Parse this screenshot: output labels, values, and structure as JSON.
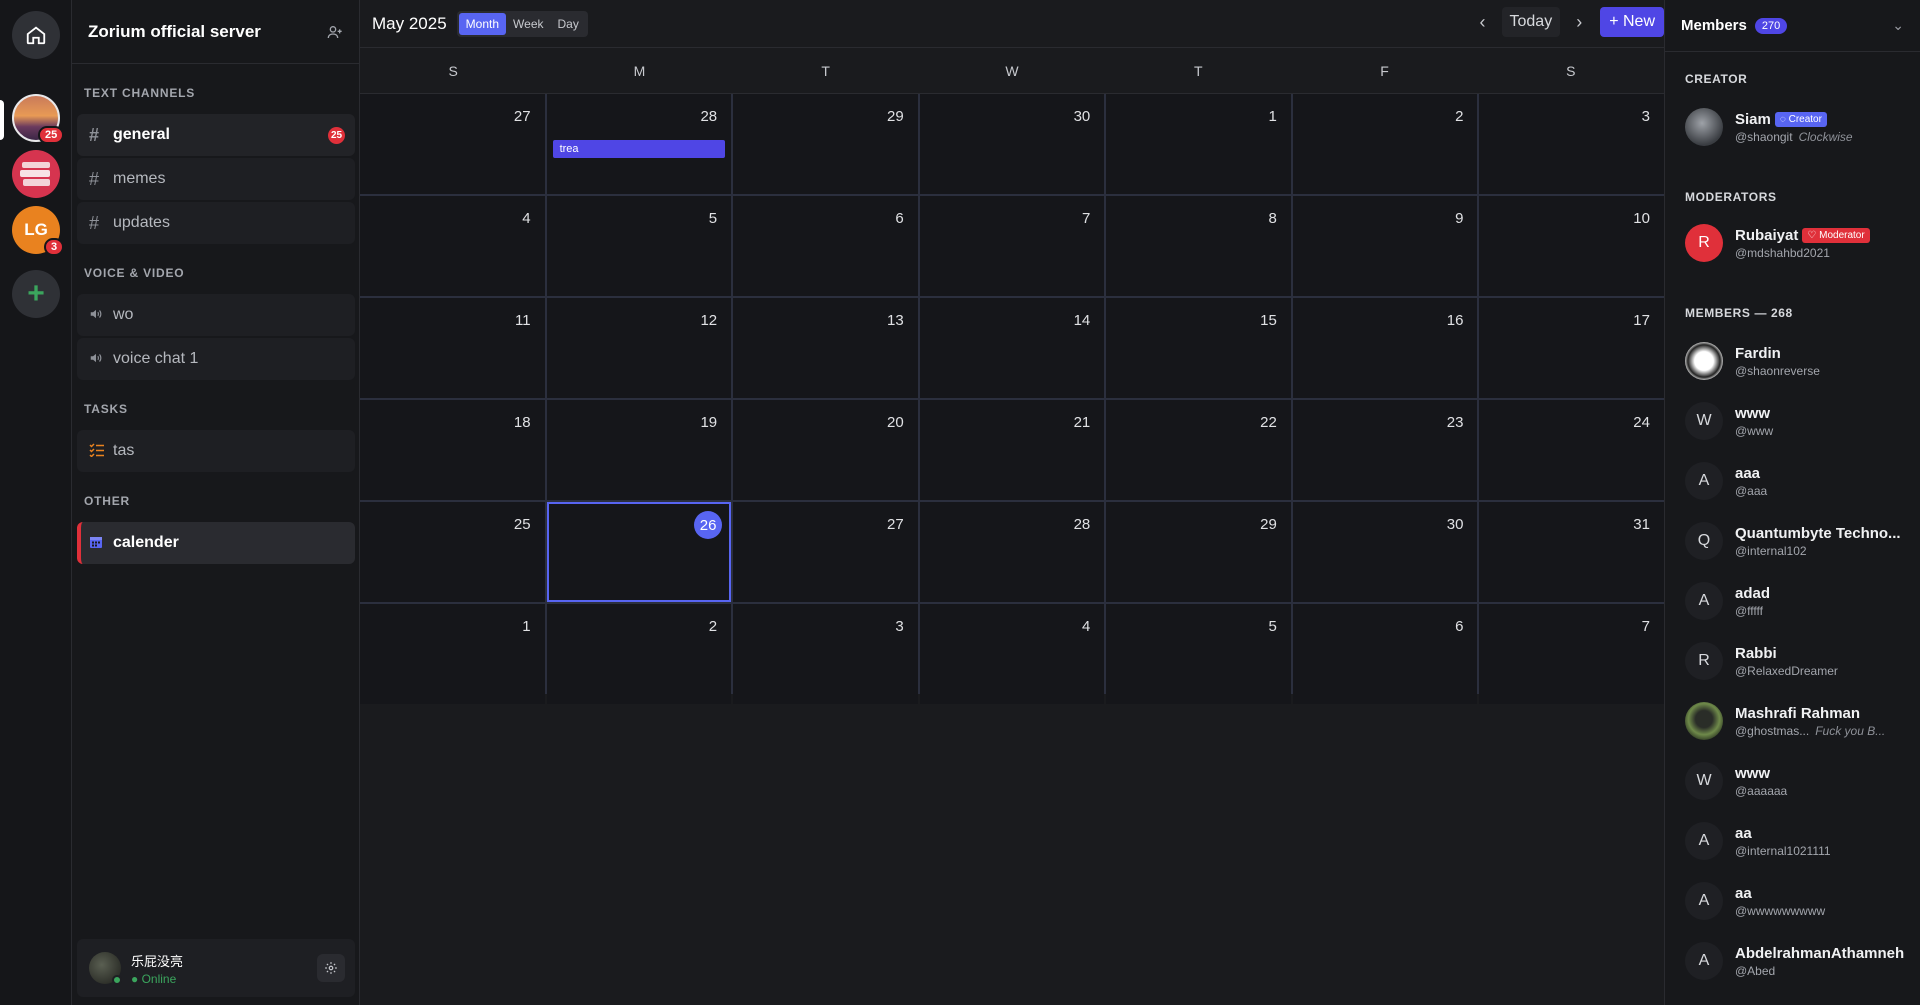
{
  "rail": {
    "server3_initials": "LG",
    "badge1": "25",
    "badge3": "3",
    "add_symbol": "+"
  },
  "server": {
    "name": "Zorium official server"
  },
  "sections": {
    "text": "TEXT CHANNELS",
    "voice": "VOICE & VIDEO",
    "tasks": "TASKS",
    "other": "OTHER"
  },
  "channels": {
    "general": {
      "label": "general",
      "badge": "25"
    },
    "memes": {
      "label": "memes"
    },
    "updates": {
      "label": "updates"
    },
    "wo": {
      "label": "wo"
    },
    "voice_chat": {
      "label": "voice chat 1"
    },
    "tas": {
      "label": "tas"
    },
    "calender": {
      "label": "calender"
    }
  },
  "user": {
    "name": "乐屁没亮",
    "status": "Online"
  },
  "calendar": {
    "title": "May 2025",
    "views": [
      "Month",
      "Week",
      "Day"
    ],
    "today_label": "Today",
    "new_label": "+ New",
    "weekdays": [
      "S",
      "M",
      "T",
      "W",
      "T",
      "F",
      "S"
    ],
    "days": [
      "27",
      "28",
      "29",
      "30",
      "1",
      "2",
      "3",
      "4",
      "5",
      "6",
      "7",
      "8",
      "9",
      "10",
      "11",
      "12",
      "13",
      "14",
      "15",
      "16",
      "17",
      "18",
      "19",
      "20",
      "21",
      "22",
      "23",
      "24",
      "25",
      "26",
      "27",
      "28",
      "29",
      "30",
      "31",
      "1",
      "2",
      "3",
      "4",
      "5",
      "6",
      "7"
    ],
    "today_index": 29,
    "event": {
      "index": 1,
      "label": "trea"
    }
  },
  "members": {
    "title": "Members",
    "count": "270",
    "creator_section": "CREATOR",
    "mod_section": "MODERATORS",
    "members_section": "MEMBERS — 268",
    "creator": {
      "name": "Siam",
      "handle": "@shaongit",
      "note": "Clockwise",
      "role": "Creator"
    },
    "moderator": {
      "name": "Rubaiyat",
      "handle": "@mdshahbd2021",
      "role": "Moderator",
      "initial": "R"
    },
    "list": [
      {
        "name": "Fardin",
        "handle": "@shaonreverse",
        "initial": ""
      },
      {
        "name": "www",
        "handle": "@www",
        "initial": "W"
      },
      {
        "name": "aaa",
        "handle": "@aaa",
        "initial": "A"
      },
      {
        "name": "Quantumbyte Techno...",
        "handle": "@internal102",
        "initial": "Q"
      },
      {
        "name": "adad",
        "handle": "@fffff",
        "initial": "A"
      },
      {
        "name": "Rabbi",
        "handle": "@RelaxedDreamer",
        "initial": "R"
      },
      {
        "name": "Mashrafi Rahman",
        "handle": "@ghostmas...",
        "note": "Fuck you B...",
        "initial": ""
      },
      {
        "name": "www",
        "handle": "@aaaaaa",
        "initial": "W"
      },
      {
        "name": "aa",
        "handle": "@internal1021111",
        "initial": "A"
      },
      {
        "name": "aa",
        "handle": "@wwwwwwwww",
        "initial": "A"
      },
      {
        "name": "AbdelrahmanAthamneh",
        "handle": "@Abed",
        "initial": "A"
      }
    ]
  }
}
